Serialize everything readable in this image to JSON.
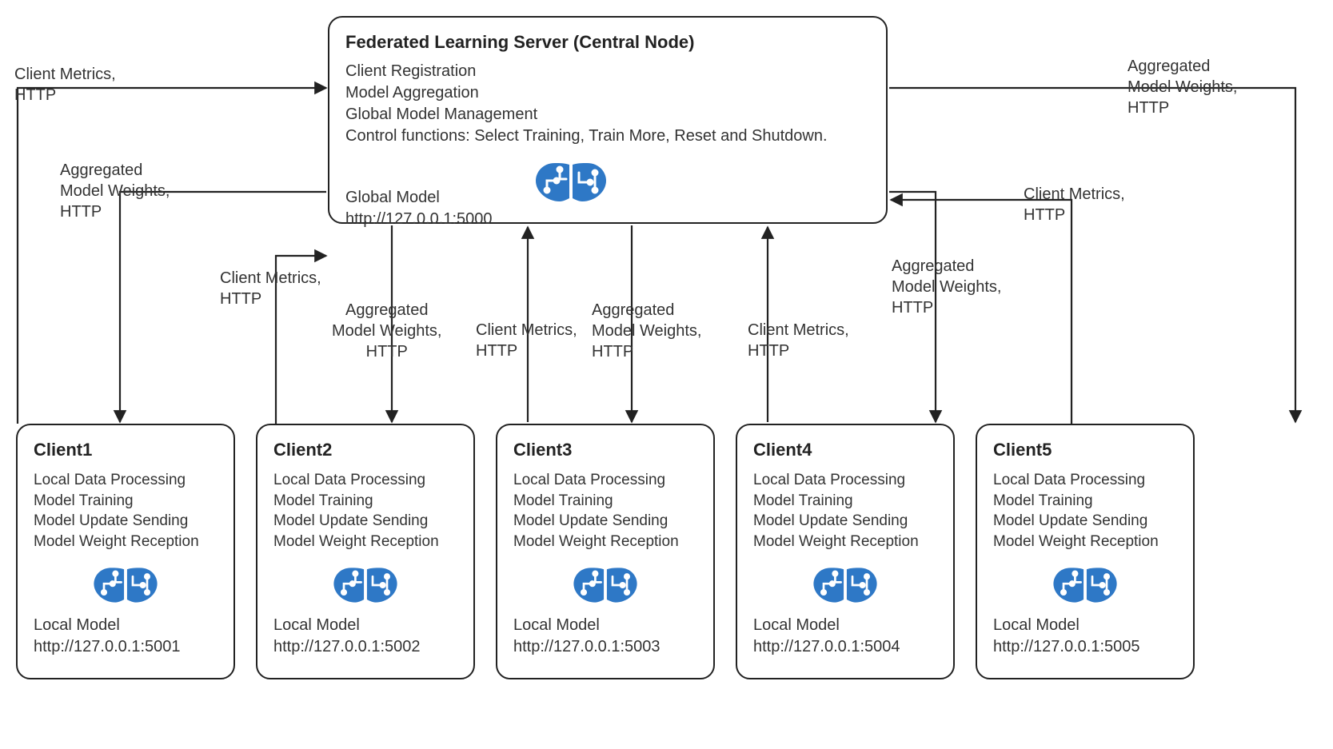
{
  "server": {
    "title": "Federated Learning Server (Central Node)",
    "lines": [
      "Client Registration",
      "Model Aggregation",
      "Global Model Management",
      "Control functions: Select Training, Train More, Reset and Shutdown."
    ],
    "foot1": "Global Model",
    "foot2": "http://127.0.0.1:5000",
    "icon": "brain-chip-icon"
  },
  "clients": [
    {
      "title": "Client1",
      "foot2": "http://127.0.0.1:5001"
    },
    {
      "title": "Client2",
      "foot2": "http://127.0.0.1:5002"
    },
    {
      "title": "Client3",
      "foot2": "http://127.0.0.1:5003"
    },
    {
      "title": "Client4",
      "foot2": "http://127.0.0.1:5004"
    },
    {
      "title": "Client5",
      "foot2": "http://127.0.0.1:5005"
    }
  ],
  "client_common": {
    "lines": [
      "Local Data Processing",
      "Model Training",
      "Model Update Sending",
      "Model Weight Reception"
    ],
    "foot1": "Local Model",
    "icon": "brain-chip-icon"
  },
  "labels": {
    "metrics": "Client Metrics,\nHTTP",
    "weights": "Aggregated\nModel Weights,\nHTTP"
  },
  "edges_description": [
    {
      "from": "Client1",
      "to": "Server",
      "via": "HTTP",
      "payload": "Client Metrics"
    },
    {
      "from": "Server",
      "to": "Client1",
      "via": "HTTP",
      "payload": "Aggregated Model Weights"
    },
    {
      "from": "Client2",
      "to": "Server",
      "via": "HTTP",
      "payload": "Client Metrics"
    },
    {
      "from": "Server",
      "to": "Client2",
      "via": "HTTP",
      "payload": "Aggregated Model Weights"
    },
    {
      "from": "Client3",
      "to": "Server",
      "via": "HTTP",
      "payload": "Client Metrics"
    },
    {
      "from": "Server",
      "to": "Client3",
      "via": "HTTP",
      "payload": "Aggregated Model Weights"
    },
    {
      "from": "Client4",
      "to": "Server",
      "via": "HTTP",
      "payload": "Client Metrics"
    },
    {
      "from": "Server",
      "to": "Client4",
      "via": "HTTP",
      "payload": "Aggregated Model Weights"
    },
    {
      "from": "Client5",
      "to": "Server",
      "via": "HTTP",
      "payload": "Client Metrics"
    },
    {
      "from": "Server",
      "to": "Client5",
      "via": "HTTP",
      "payload": "Aggregated Model Weights"
    }
  ]
}
